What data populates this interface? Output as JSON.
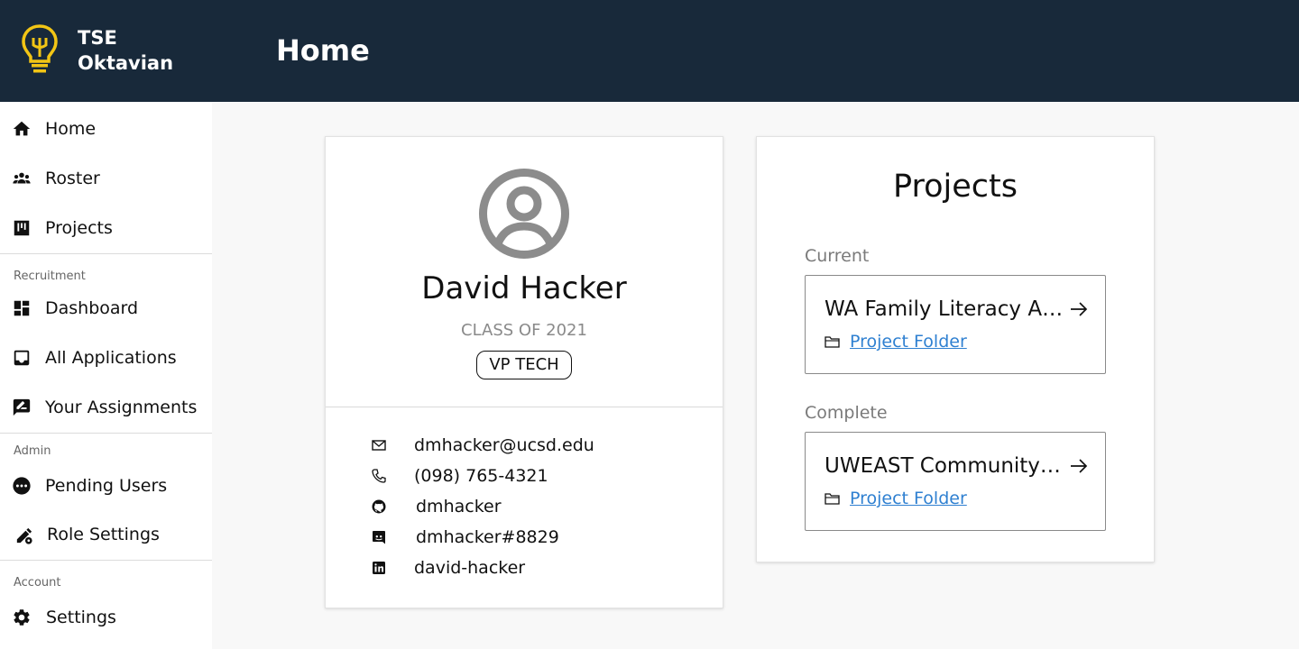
{
  "header": {
    "brand_line1": "TSE",
    "brand_line2": "Oktavian",
    "page_title": "Home",
    "logo_color": "#f2c515",
    "bg_color": "#18293a"
  },
  "sidebar": {
    "main_items": [
      {
        "label": "Home",
        "icon": "home-icon"
      },
      {
        "label": "Roster",
        "icon": "group-icon"
      },
      {
        "label": "Projects",
        "icon": "kanban-icon"
      }
    ],
    "recruitment_label": "Recruitment",
    "recruitment_items": [
      {
        "label": "Dashboard",
        "icon": "dashboard-icon"
      },
      {
        "label": "All Applications",
        "icon": "inbox-icon"
      },
      {
        "label": "Your Assignments",
        "icon": "rate-review-icon"
      }
    ],
    "admin_label": "Admin",
    "admin_items": [
      {
        "label": "Pending Users",
        "icon": "pending-icon"
      },
      {
        "label": "Role Settings",
        "icon": "person-settings-icon"
      }
    ],
    "account_label": "Account",
    "account_items": [
      {
        "label": "Settings",
        "icon": "gear-icon"
      }
    ]
  },
  "profile": {
    "name": "David Hacker",
    "class_of": "CLASS OF 2021",
    "role": "VP TECH",
    "contacts": [
      {
        "icon": "mail-icon",
        "value": "dmhacker@ucsd.edu"
      },
      {
        "icon": "phone-icon",
        "value": "(098) 765-4321"
      },
      {
        "icon": "github-icon",
        "value": "dmhacker"
      },
      {
        "icon": "discord-icon",
        "value": "dmhacker#8829"
      },
      {
        "icon": "linkedin-icon",
        "value": "david-hacker"
      }
    ]
  },
  "projects": {
    "title": "Projects",
    "current_label": "Current",
    "current": [
      {
        "name": "WA Family Literacy App",
        "folder_label": "Project Folder"
      }
    ],
    "complete_label": "Complete",
    "complete": [
      {
        "name": "UWEAST Community Kitchen",
        "folder_label": "Project Folder"
      }
    ],
    "link_color": "#2f80d1"
  }
}
